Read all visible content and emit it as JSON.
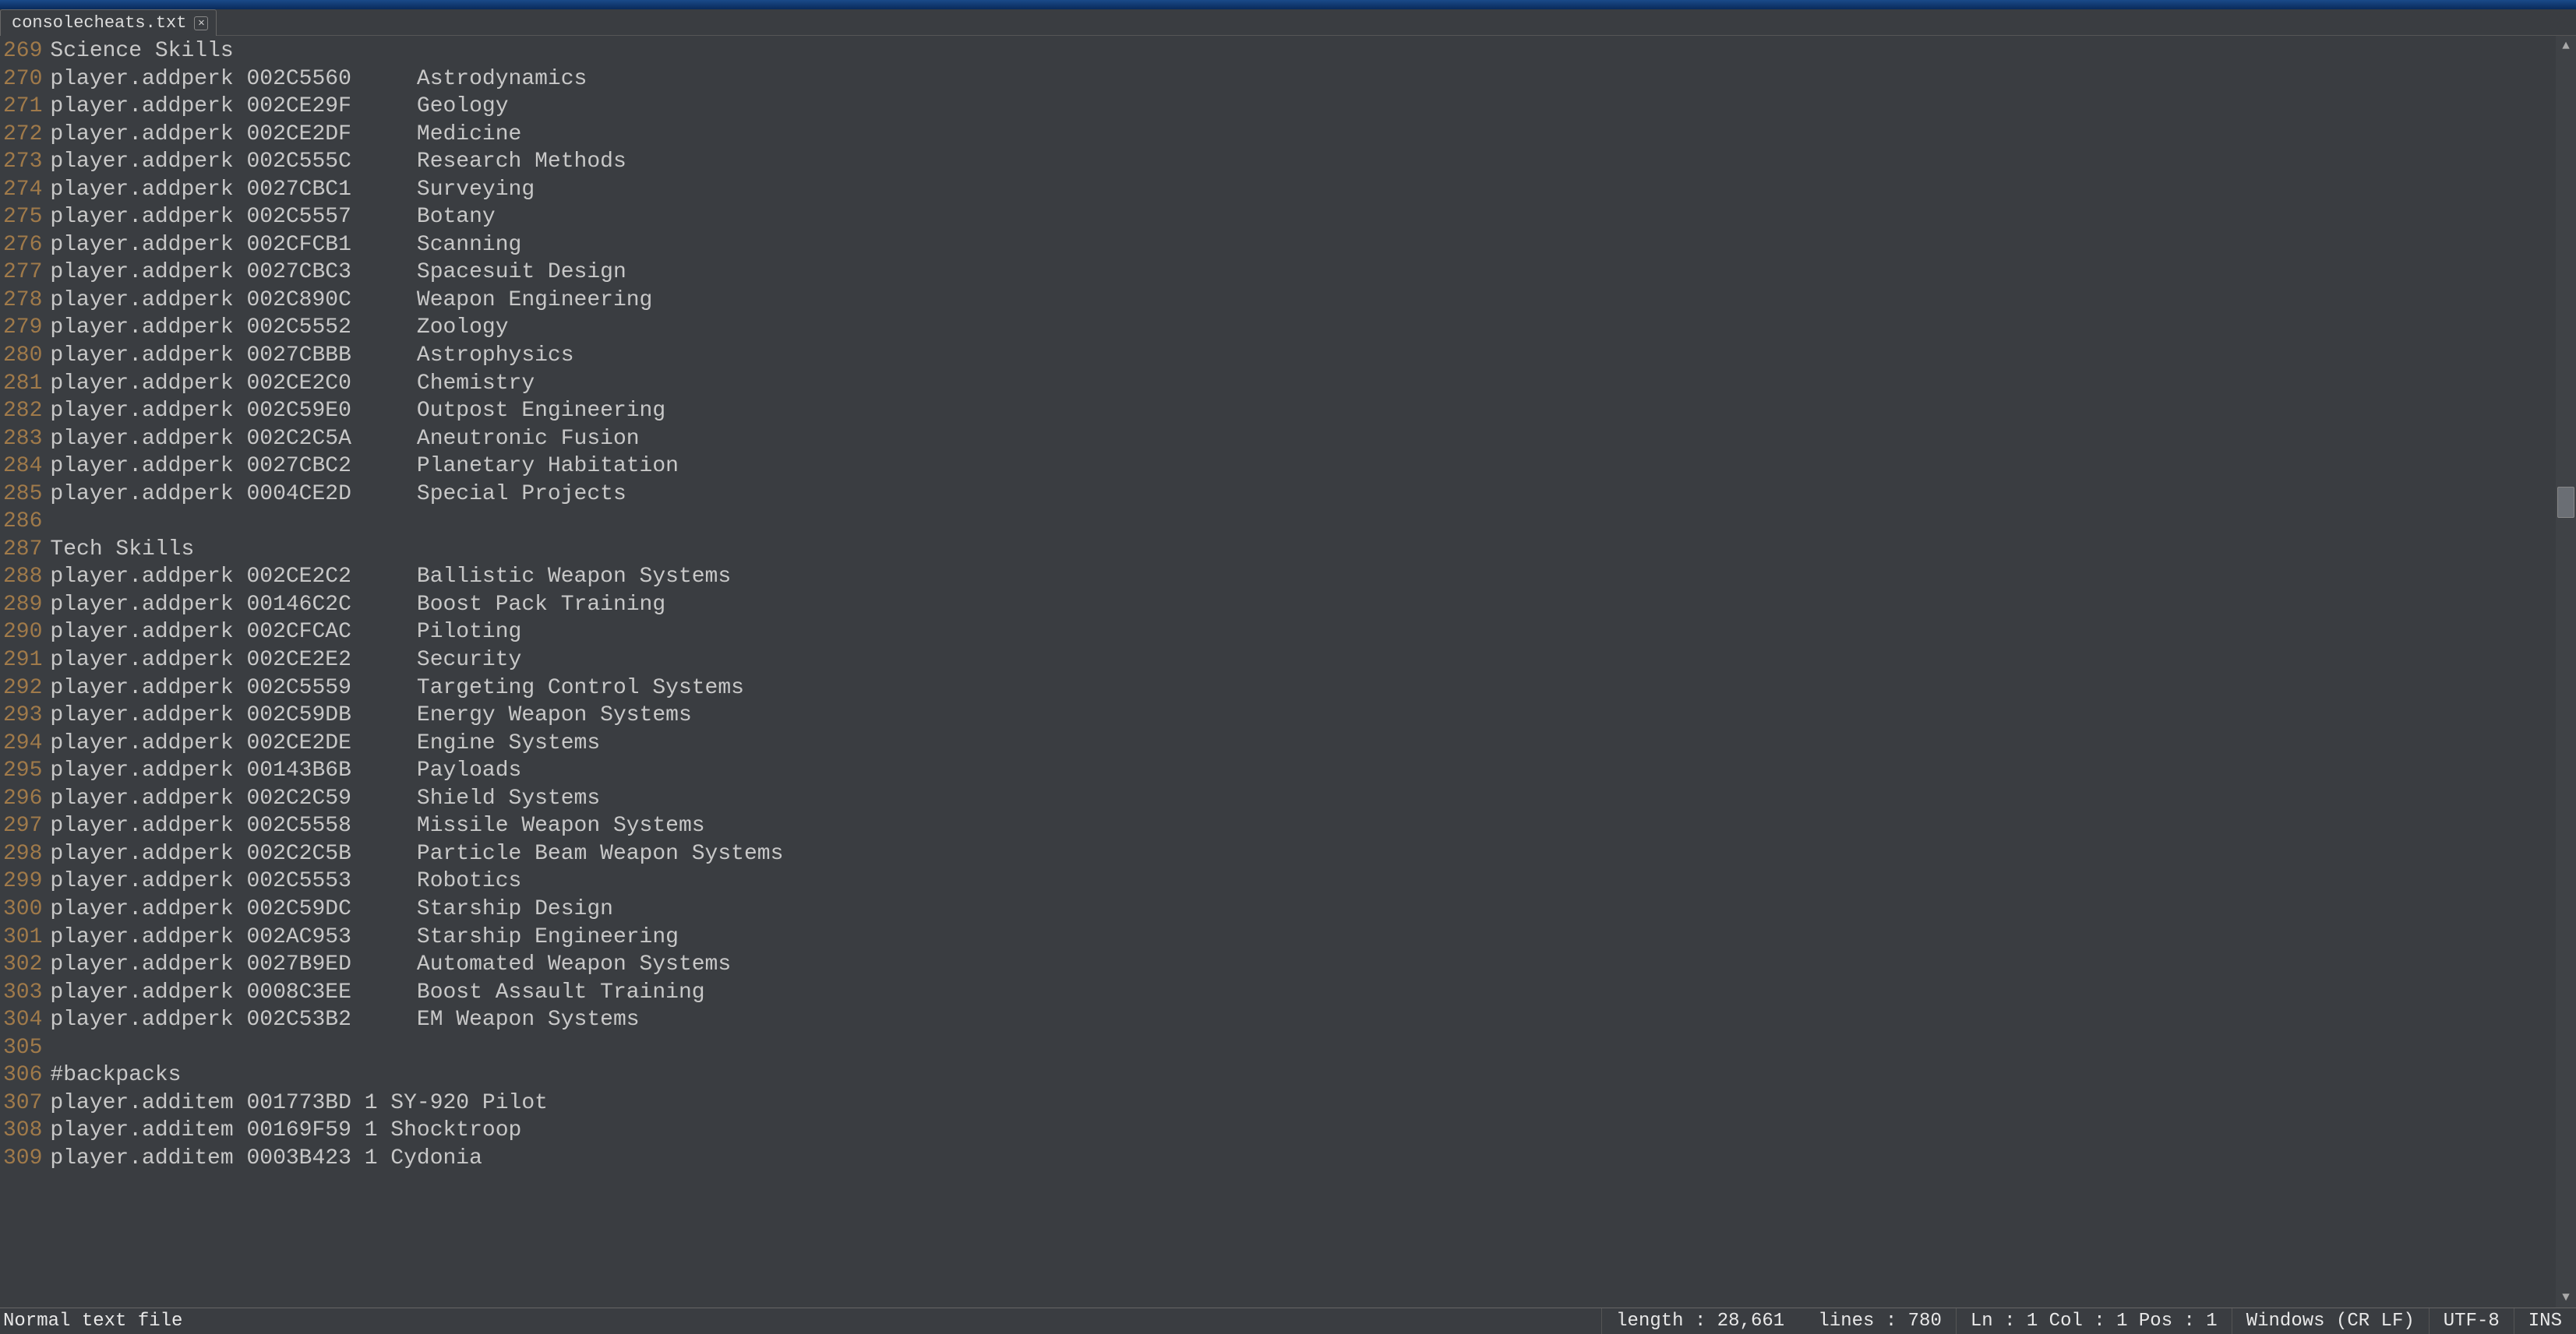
{
  "tab": {
    "name": "consolecheats.txt",
    "close": "✕"
  },
  "editor": {
    "start_line_number": 269,
    "lines": [
      "Science Skills",
      "player.addperk 002C5560     Astrodynamics",
      "player.addperk 002CE29F     Geology",
      "player.addperk 002CE2DF     Medicine",
      "player.addperk 002C555C     Research Methods",
      "player.addperk 0027CBC1     Surveying",
      "player.addperk 002C5557     Botany",
      "player.addperk 002CFCB1     Scanning",
      "player.addperk 0027CBC3     Spacesuit Design",
      "player.addperk 002C890C     Weapon Engineering",
      "player.addperk 002C5552     Zoology",
      "player.addperk 0027CBBB     Astrophysics",
      "player.addperk 002CE2C0     Chemistry",
      "player.addperk 002C59E0     Outpost Engineering",
      "player.addperk 002C2C5A     Aneutronic Fusion",
      "player.addperk 0027CBC2     Planetary Habitation",
      "player.addperk 0004CE2D     Special Projects",
      "",
      "Tech Skills",
      "player.addperk 002CE2C2     Ballistic Weapon Systems",
      "player.addperk 00146C2C     Boost Pack Training",
      "player.addperk 002CFCAC     Piloting",
      "player.addperk 002CE2E2     Security",
      "player.addperk 002C5559     Targeting Control Systems",
      "player.addperk 002C59DB     Energy Weapon Systems",
      "player.addperk 002CE2DE     Engine Systems",
      "player.addperk 00143B6B     Payloads",
      "player.addperk 002C2C59     Shield Systems",
      "player.addperk 002C5558     Missile Weapon Systems",
      "player.addperk 002C2C5B     Particle Beam Weapon Systems",
      "player.addperk 002C5553     Robotics",
      "player.addperk 002C59DC     Starship Design",
      "player.addperk 002AC953     Starship Engineering",
      "player.addperk 0027B9ED     Automated Weapon Systems",
      "player.addperk 0008C3EE     Boost Assault Training",
      "player.addperk 002C53B2     EM Weapon Systems",
      "",
      "#backpacks",
      "player.additem 001773BD 1 SY-920 Pilot",
      "player.additem 00169F59 1 Shocktroop",
      "player.additem 0003B423 1 Cydonia"
    ]
  },
  "status": {
    "file_type": "Normal text file",
    "length_label": "length : 28,661",
    "lines_label": "lines : 780",
    "pos_label": "Ln : 1   Col : 1   Pos : 1",
    "eol": "Windows (CR LF)",
    "encoding": "UTF-8",
    "ins": "INS"
  }
}
